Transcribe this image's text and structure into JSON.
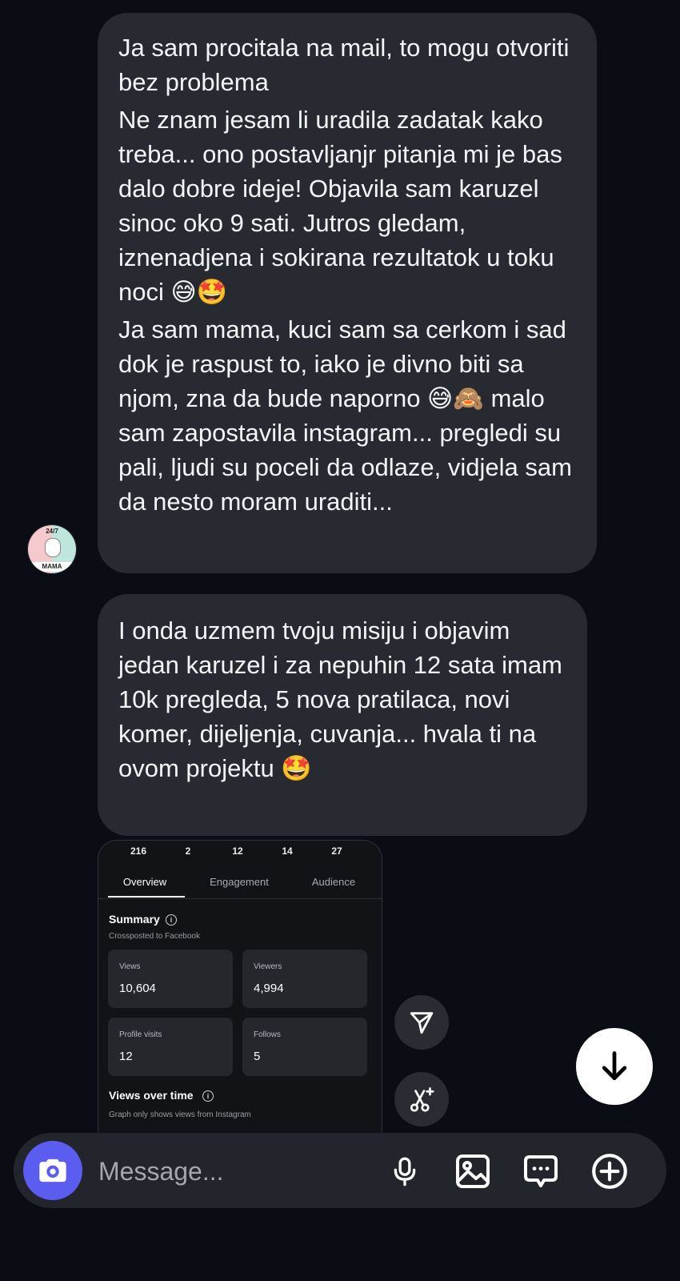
{
  "messages": [
    {
      "lines": [
        "Ja sam procitala na mail, to mogu otvoriti bez problema",
        "Ne znam jesam li uradila zadatak kako treba... ono postavljanjr pitanja mi je bas dalo dobre ideje! Objavila sam karuzel sinoc oko 9 sati. Jutros gledam, iznenadjena i sokirana rezultatok u toku noci 😅🤩",
        "Ja sam mama, kuci sam sa cerkom i sad dok je raspust to, iako je divno biti sa njom, zna da bude naporno 😅🙈 malo sam zapostavila instagram... pregledi su pali, ljudi su poceli da odlaze, vidjela sam da nesto moram uraditi..."
      ]
    },
    {
      "text": "I onda uzmem tvoju misiju i objavim jedan karuzel i za nepuhin 12 sata imam 10k pregleda, 5 nova pratilaca, novi komer, dijeljenja, cuvanja... hvala ti na ovom projektu 🤩"
    }
  ],
  "avatar": {
    "top_text": "24/7",
    "bottom_text": "MAMA"
  },
  "insights": {
    "top_stats": [
      "216",
      "2",
      "12",
      "14",
      "27"
    ],
    "tabs": [
      "Overview",
      "Engagement",
      "Audience"
    ],
    "active_tab": "Overview",
    "summary_title": "Summary",
    "crossposted": "Crossposted to Facebook",
    "cards": [
      {
        "label": "Views",
        "value": "10,604"
      },
      {
        "label": "Viewers",
        "value": "4,994"
      },
      {
        "label": "Profile visits",
        "value": "12"
      },
      {
        "label": "Follows",
        "value": "5"
      }
    ],
    "views_over_time_title": "Views over time",
    "graph_note": "Graph only shows views from Instagram"
  },
  "composer": {
    "placeholder": "Message..."
  },
  "icons": {
    "forward": "paper-plane-icon",
    "ai": "ai-scissors-sparkle-icon",
    "scroll_down": "arrow-down-icon",
    "camera": "camera-icon",
    "mic": "microphone-icon",
    "gallery": "image-icon",
    "sticker": "chat-bubble-icon",
    "plus": "plus-circle-icon"
  },
  "colors": {
    "background": "#0b0d14",
    "bubble": "#272a31",
    "camera_accent": "#5b5cf0"
  }
}
